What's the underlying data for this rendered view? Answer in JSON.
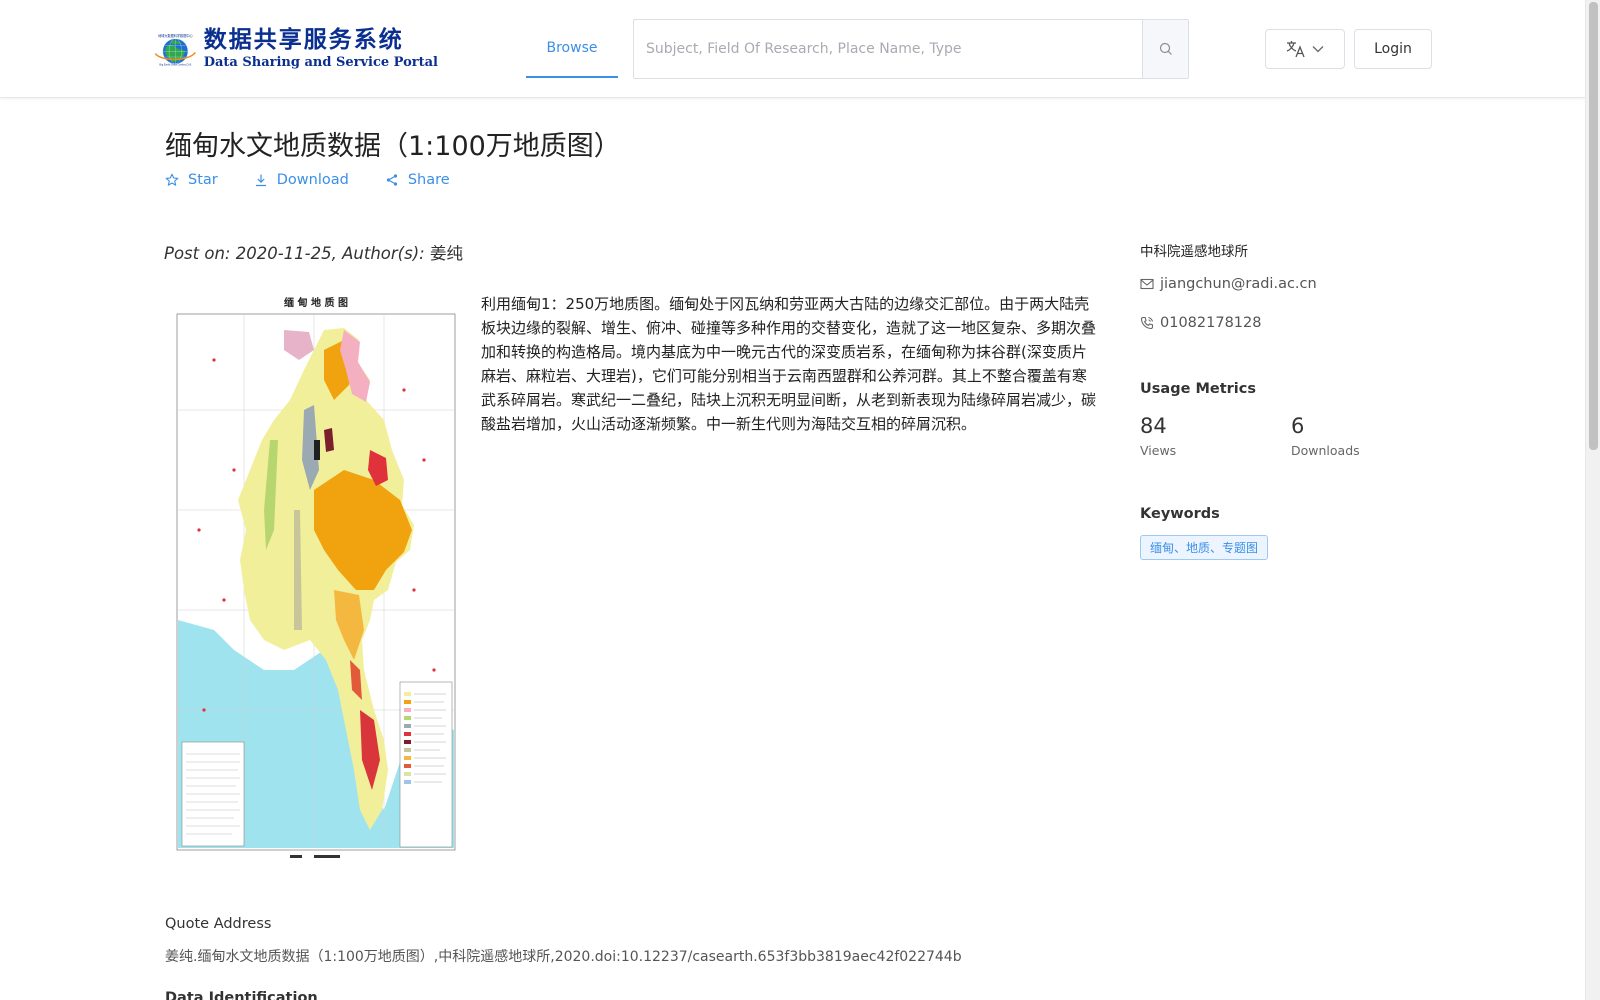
{
  "header": {
    "logo_cn": "数据共享服务系统",
    "logo_en": "Data Sharing and Service Portal",
    "logo_arc_text": "地球大数据科学数据中心",
    "logo_sub_text": "Big Earth Data Center,CAS",
    "nav_browse": "Browse",
    "search_placeholder": "Subject, Field Of Research, Place Name, Type",
    "login_label": "Login",
    "lang_icon": "translate-icon"
  },
  "dataset": {
    "title": "缅甸水文地质数据（1:100万地质图）",
    "actions": [
      {
        "label": "Star",
        "icon": "star-icon"
      },
      {
        "label": "Download",
        "icon": "download-icon"
      },
      {
        "label": "Share",
        "icon": "share-icon"
      }
    ],
    "post_on_label": "Post on:",
    "post_date": "2020-11-25,",
    "author_label": "Author(s):",
    "author": "姜纯",
    "map_title": "缅 甸 地 质 图",
    "description": "利用缅甸1：250万地质图。缅甸处于冈瓦纳和劳亚两大古陆的边缘交汇部位。由于两大陆壳板块边缘的裂解、增生、俯冲、碰撞等多种作用的交替变化，造就了这一地区复杂、多期次叠加和转换的构造格局。境内基底为中一晚元古代的深变质岩系，在缅甸称为抹谷群(深变质片麻岩、麻粒岩、大理岩)，它们可能分别相当于云南西盟群和公养河群。其上不整合覆盖有寒武系碎屑岩。寒武纪一二叠纪，陆块上沉积无明显间断，从老到新表现为陆缘碎屑岩减少，碳酸盐岩增加，火山活动逐渐频繁。中一新生代则为海陆交互相的碎屑沉积。"
  },
  "sidebar": {
    "organization": "中科院遥感地球所",
    "email": "jiangchun@radi.ac.cn",
    "phone": "01082178128",
    "usage_heading": "Usage Metrics",
    "views_value": "84",
    "views_label": "Views",
    "downloads_value": "6",
    "downloads_label": "Downloads",
    "keywords_heading": "Keywords",
    "keywords": [
      "缅甸、地质、专题图"
    ]
  },
  "quote": {
    "heading": "Quote Address",
    "text": "姜纯.缅甸水文地质数据（1:100万地质图）,中科院遥感地球所,2020.doi:10.12237/casearth.653f3bb3819aec42f022744b"
  },
  "next_section": "Data Identification",
  "colors": {
    "accent": "#3b8fe6",
    "logo_blue": "#0a2f8f"
  }
}
